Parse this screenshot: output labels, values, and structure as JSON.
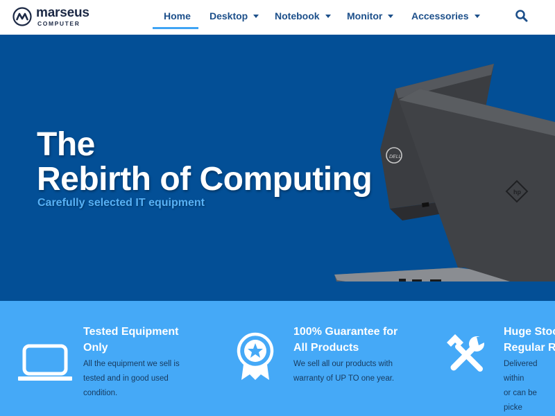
{
  "brand": {
    "name": "marseus",
    "sub": "COMPUTER",
    "accent": "#1c2945"
  },
  "nav": {
    "items": [
      {
        "label": "Home",
        "active": true,
        "dropdown": false
      },
      {
        "label": "Desktop",
        "active": false,
        "dropdown": true
      },
      {
        "label": "Notebook",
        "active": false,
        "dropdown": true
      },
      {
        "label": "Monitor",
        "active": false,
        "dropdown": true
      },
      {
        "label": "Accessories",
        "active": false,
        "dropdown": true
      }
    ],
    "search_icon": "search-icon",
    "underline_color": "#3fa4f4"
  },
  "hero": {
    "title_line1": "The",
    "title_line2": "Rebirth of Computing",
    "subtitle": "Carefully selected IT equipment",
    "background": "#034f96"
  },
  "features": {
    "background": "#45a9f7",
    "items": [
      {
        "icon": "laptop-icon",
        "title_line1": "Tested Equipment",
        "title_line2": "Only",
        "text_line1": "All the equipment we sell is",
        "text_line2": "tested and in good used",
        "text_line3": "condition."
      },
      {
        "icon": "award-star-icon",
        "title_line1": "100% Guarantee for",
        "title_line2": "All Products",
        "text_line1": "We sell all our products with",
        "text_line2": "warranty of UP TO one year.",
        "text_line3": ""
      },
      {
        "icon": "tools-icon",
        "title_line1": "Huge Stock",
        "title_line2": "Regular Re",
        "text_line1": "Delivered within",
        "text_line2": "or can be picke",
        "text_line3": ""
      }
    ]
  }
}
